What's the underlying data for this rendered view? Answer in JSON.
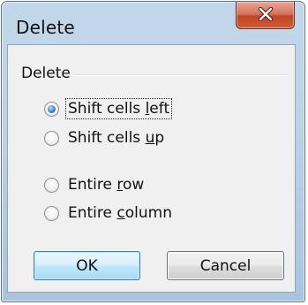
{
  "dialog": {
    "title": "Delete"
  },
  "group": {
    "label": "Delete"
  },
  "options": [
    {
      "pre": "Shift cells ",
      "accel": "l",
      "post": "eft",
      "selected": true
    },
    {
      "pre": "Shift cells ",
      "accel": "u",
      "post": "p",
      "selected": false
    },
    {
      "pre": "Entire ",
      "accel": "r",
      "post": "ow",
      "selected": false
    },
    {
      "pre": "Entire ",
      "accel": "c",
      "post": "olumn",
      "selected": false
    }
  ],
  "buttons": {
    "ok": "OK",
    "cancel": "Cancel"
  },
  "icons": {
    "close": "close-icon"
  },
  "colors": {
    "close_button": "#c8503a",
    "dialog_frame": "#bcd2e7",
    "client_bg": "#f0f0f0",
    "ok_border": "#3c7fb1"
  }
}
